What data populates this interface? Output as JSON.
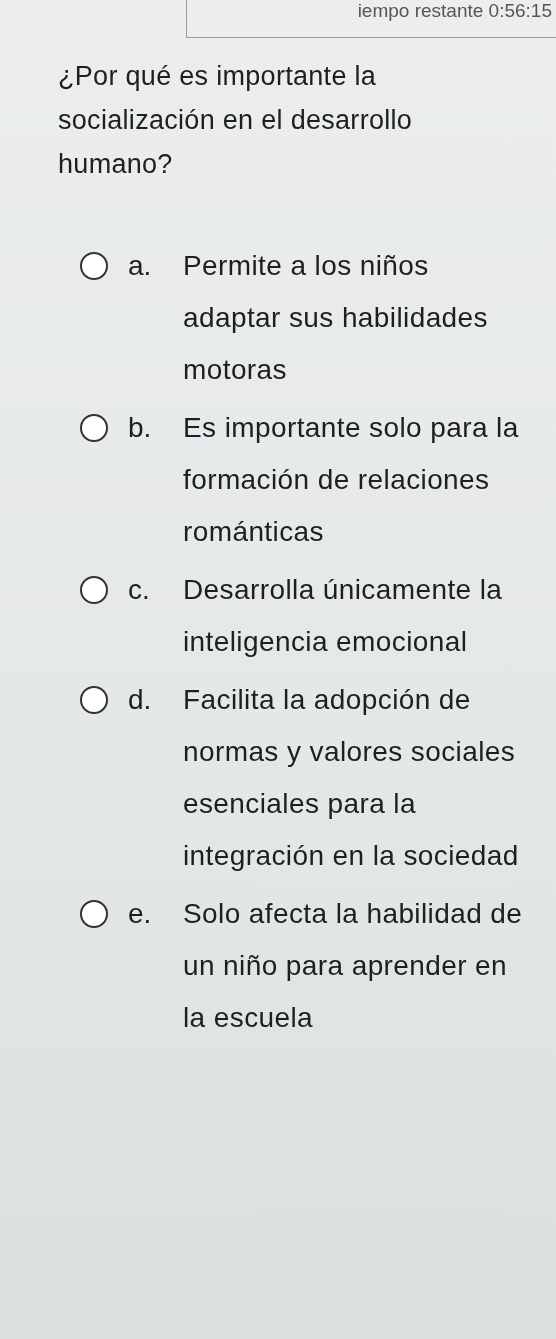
{
  "timer": {
    "text": "iempo restante 0:56:15"
  },
  "question": {
    "text": "¿Por qué es importante la socialización en el desarrollo humano?"
  },
  "options": [
    {
      "letter": "a.",
      "text": "Permite a los niños adaptar sus habilidades motoras",
      "selected": false
    },
    {
      "letter": "b.",
      "text": "Es importante solo para la formación de relaciones románticas",
      "selected": false
    },
    {
      "letter": "c.",
      "text": "Desarrolla únicamente la inteligencia emocional",
      "selected": false
    },
    {
      "letter": "d.",
      "text": "Facilita la adopción de normas y valores sociales esenciales para la integración en la sociedad",
      "selected": false
    },
    {
      "letter": "e.",
      "text": "Solo afecta la habilidad de un niño para aprender en la escuela",
      "selected": false
    }
  ]
}
